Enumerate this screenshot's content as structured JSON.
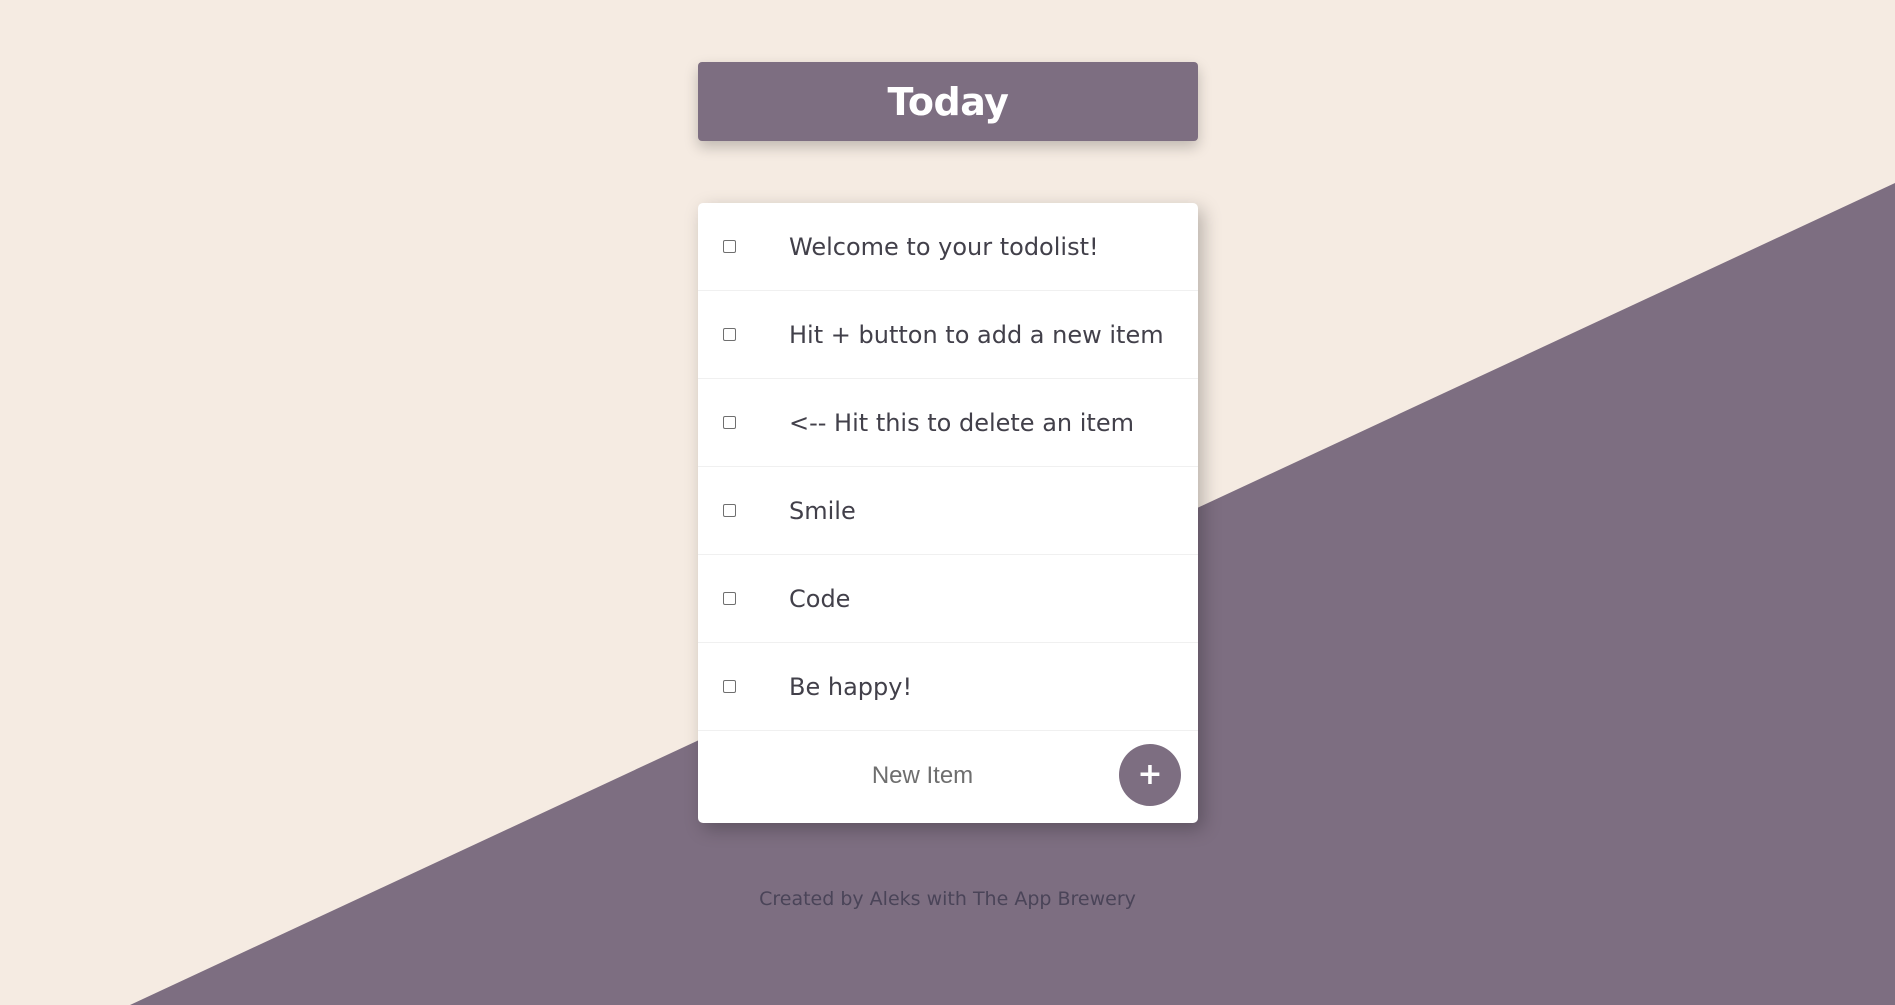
{
  "colors": {
    "background": "#f5ebe2",
    "accent": "#7d6e81",
    "card": "#ffffff",
    "item_text": "#42404a"
  },
  "header": {
    "title": "Today"
  },
  "todo": {
    "items": [
      {
        "label": "Welcome to your todolist!",
        "checked": false
      },
      {
        "label": "Hit + button to add a new item",
        "checked": false
      },
      {
        "label": "<-- Hit this to delete an item",
        "checked": false
      },
      {
        "label": "Smile",
        "checked": false
      },
      {
        "label": "Code",
        "checked": false
      },
      {
        "label": "Be happy!",
        "checked": false
      }
    ],
    "new_item_placeholder": "New Item",
    "add_button_label": "+"
  },
  "footer": {
    "text": "Created by Aleks with The App Brewery"
  },
  "icons": {
    "add": "plus-icon",
    "checkbox": "checkbox-icon"
  }
}
